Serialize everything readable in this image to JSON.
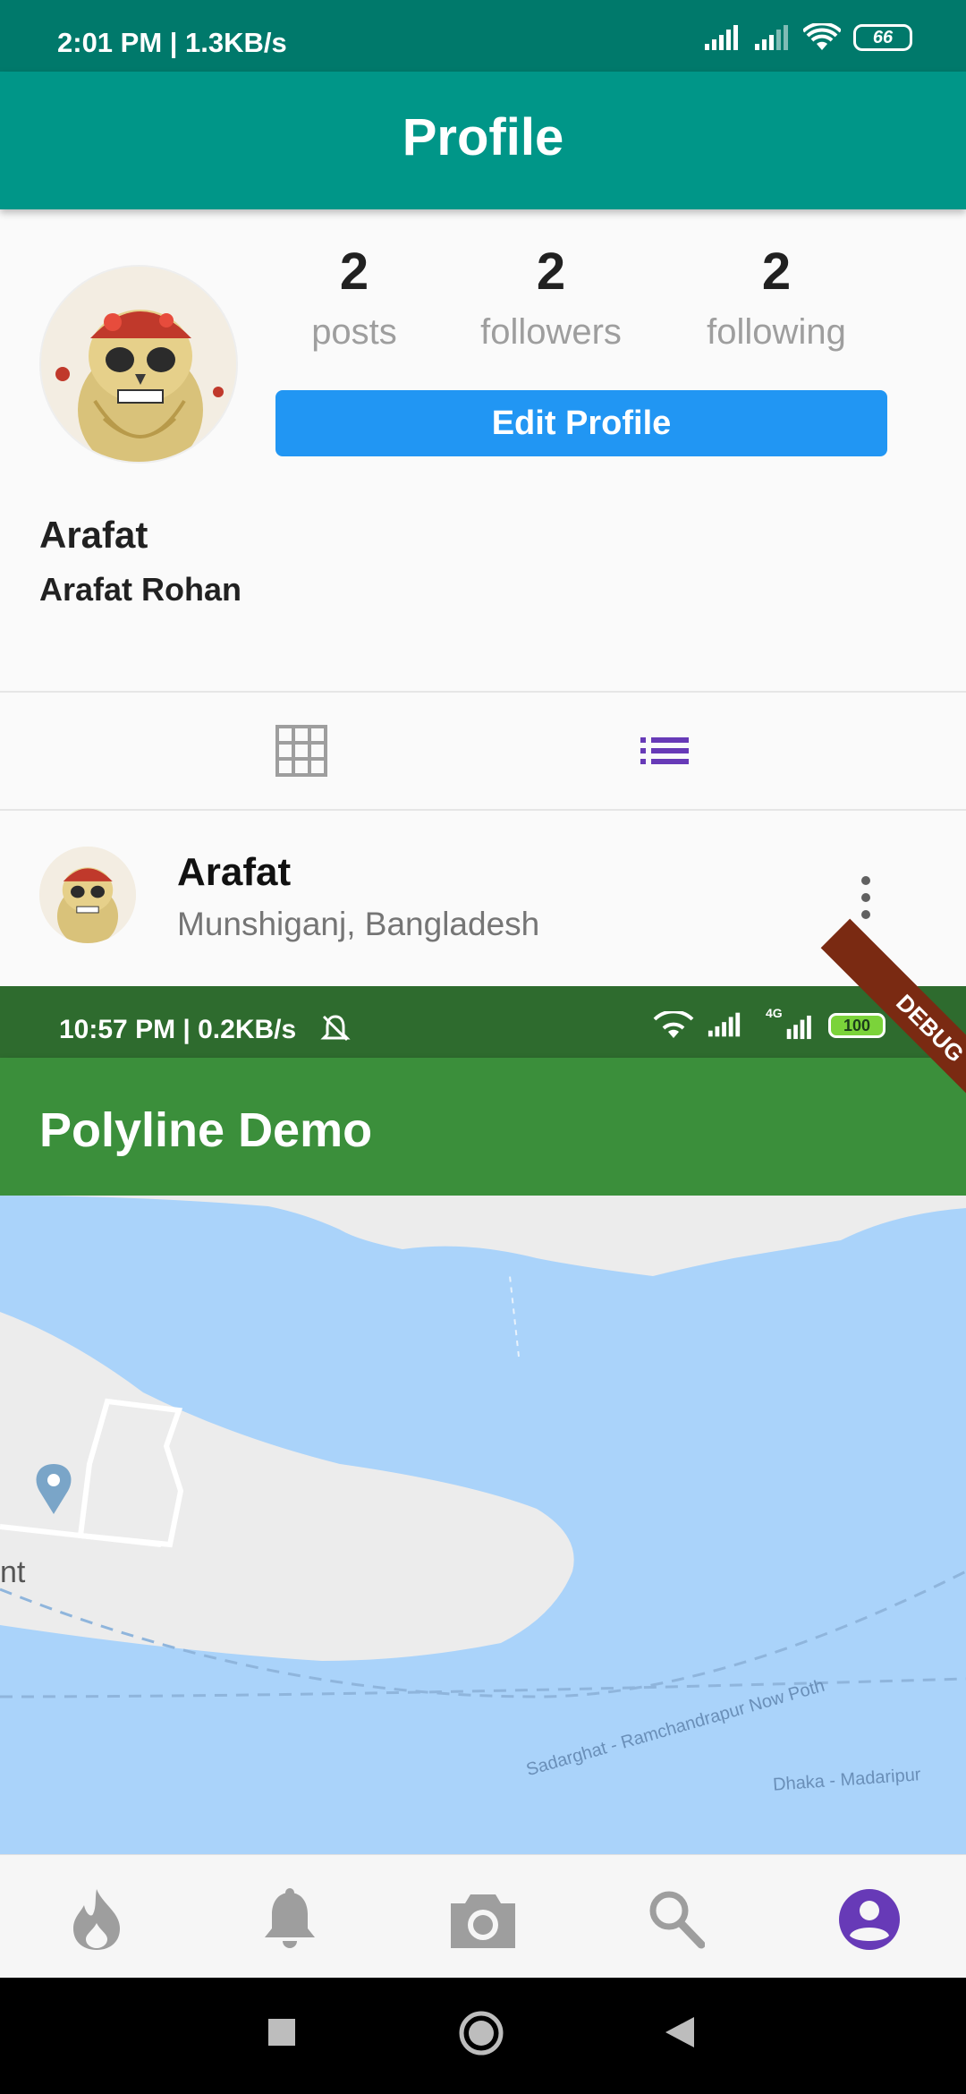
{
  "status_bar": {
    "time_speed": "2:01 PM | 1.3KB/s",
    "battery": "66"
  },
  "app_bar": {
    "title": "Profile"
  },
  "profile": {
    "stats": [
      {
        "count": "2",
        "label": "posts"
      },
      {
        "count": "2",
        "label": "followers"
      },
      {
        "count": "2",
        "label": "following"
      }
    ],
    "edit_button_label": "Edit Profile",
    "username": "Arafat",
    "full_name": "Arafat Rohan"
  },
  "view_tabs": {
    "grid_icon": "grid-icon",
    "list_icon": "list-icon",
    "active": "list"
  },
  "post": {
    "author": "Arafat",
    "location": "Munshiganj, Bangladesh"
  },
  "embedded_screenshot": {
    "status_time_speed": "10:57 PM | 0.2KB/s",
    "battery": "100",
    "network": "4G",
    "app_title": "Polyline Demo",
    "debug_banner": "DEBUG",
    "map": {
      "pin_label_fragment": "nt",
      "road_labels": [
        "Sadarghat - Ramchandrapur Now Poth",
        "Dhaka - Madaripur"
      ]
    }
  },
  "bottom_nav": {
    "items": [
      "fire-icon",
      "notifications-icon",
      "camera-icon",
      "search-icon",
      "account-icon"
    ],
    "active": "account-icon"
  },
  "colors": {
    "primary": "#009688",
    "primary_dark": "#00796b",
    "accent_purple": "#673ab7",
    "button_blue": "#2196f3",
    "embedded_green": "#3b8f3b",
    "water": "#aad3fa"
  }
}
